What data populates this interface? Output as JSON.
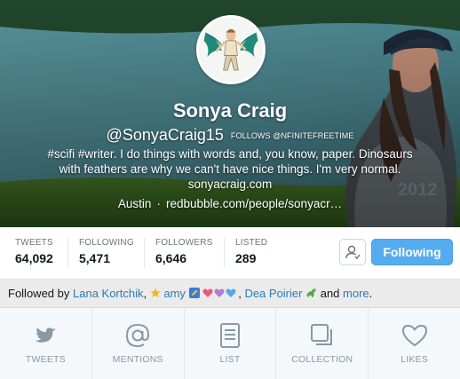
{
  "profile": {
    "name": "Sonya Craig",
    "handle": "@SonyaCraig15",
    "follows_badge": "FOLLOWS @NFINITEFREETIME",
    "bio_lines": [
      "#scifi #writer. I do things with words and, you know, paper. Dinosaurs",
      "with feathers are why we can't have nice things. I'm very normal.",
      "sonyacraig.com"
    ],
    "location": "Austin",
    "separator": "·",
    "link": "redbubble.com/people/sonyacr…"
  },
  "stats": [
    {
      "label": "TWEETS",
      "value": "64,092"
    },
    {
      "label": "FOLLOWING",
      "value": "5,471"
    },
    {
      "label": "FOLLOWERS",
      "value": "6,646"
    },
    {
      "label": "LISTED",
      "value": "289"
    }
  ],
  "actions": {
    "user_icon": "user-settings-icon",
    "follow_button_label": "Following"
  },
  "followed_by": {
    "prefix": "Followed by",
    "user1": "Lana Kortchik",
    "comma": ",",
    "user2": "amy",
    "user3": "Dea Poirier",
    "and_text": "and",
    "more": "more",
    "period": "."
  },
  "tabs": [
    {
      "label": "TWEETS",
      "icon": "bird-icon"
    },
    {
      "label": "MENTIONS",
      "icon": "at-sign-icon"
    },
    {
      "label": "LIST",
      "icon": "list-icon"
    },
    {
      "label": "COLLECTION",
      "icon": "collection-icon"
    },
    {
      "label": "LIKES",
      "icon": "heart-icon"
    }
  ],
  "colors": {
    "accent": "#55acee",
    "link": "#2b7bb9",
    "tab_icon": "#8899a6"
  }
}
